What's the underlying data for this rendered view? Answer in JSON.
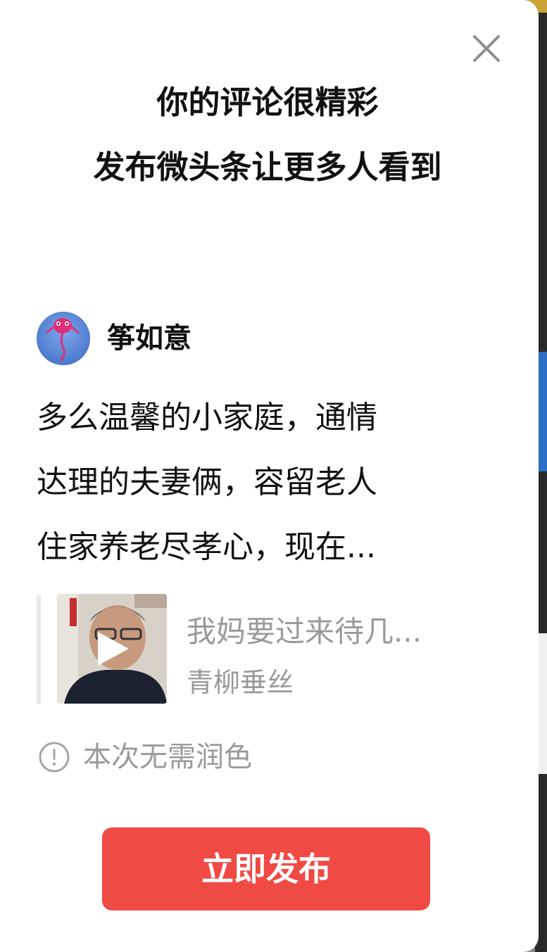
{
  "modal": {
    "title_line1": "你的评论很精彩",
    "title_line2": "发布微头条让更多人看到"
  },
  "author": {
    "name": "筝如意"
  },
  "comment": {
    "line1": "多么温馨的小家庭，通情",
    "line2": "达理的夫妻俩，容留老人",
    "line3": "住家养老尽孝心，现在..."
  },
  "reference": {
    "title": "我妈要过来待几...",
    "author": "青柳垂丝",
    "thumbnail_icon": "play-icon"
  },
  "notice": {
    "text": "本次无需润色",
    "icon": "info-icon"
  },
  "actions": {
    "publish_label": "立即发布",
    "close_icon": "close-icon"
  },
  "colors": {
    "publish_button": "#f04a45",
    "muted_text": "#9a9a9a",
    "primary_text": "#111111"
  }
}
